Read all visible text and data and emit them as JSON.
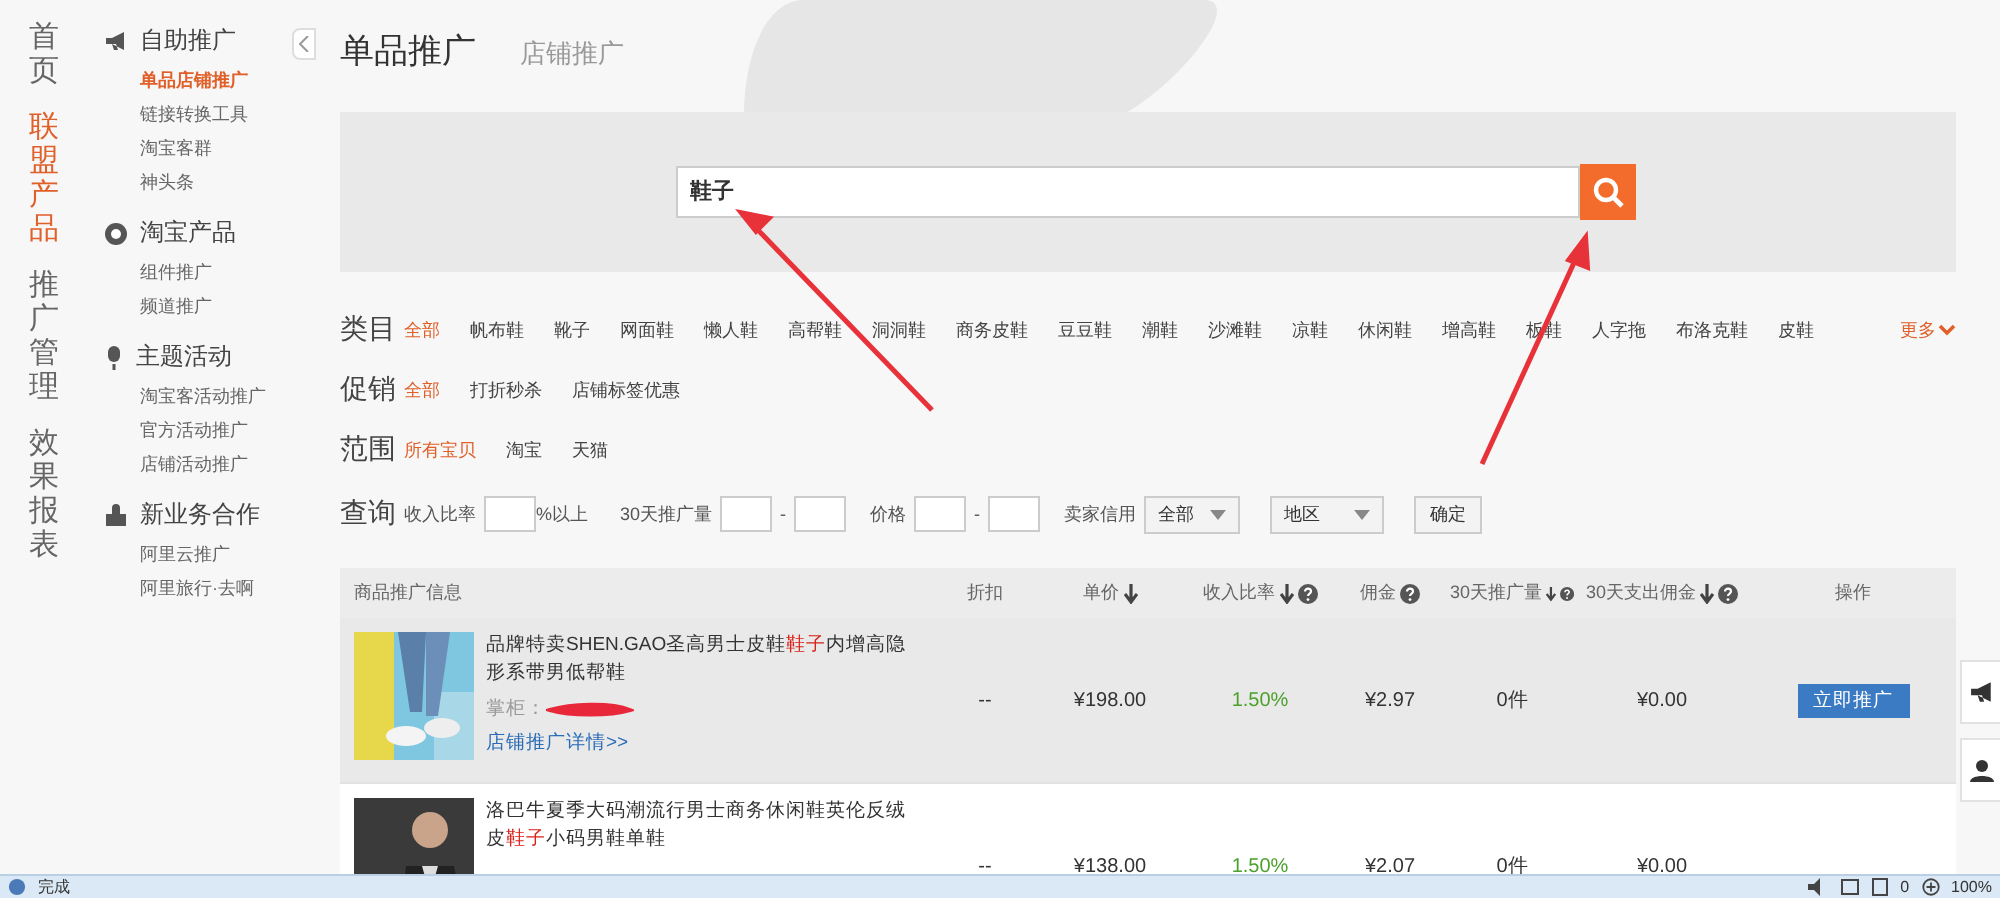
{
  "nav": [
    {
      "label": "首页",
      "selected": false
    },
    {
      "label": "联盟产品",
      "selected": true
    },
    {
      "label": "推广管理",
      "selected": false
    },
    {
      "label": "效果报表",
      "selected": false
    }
  ],
  "sidebar": {
    "groups": [
      {
        "title": "自助推广",
        "items": [
          {
            "label": "单品店铺推广",
            "selected": true
          },
          {
            "label": "链接转换工具",
            "selected": false
          },
          {
            "label": "淘宝客群",
            "selected": false
          },
          {
            "label": "神头条",
            "selected": false
          }
        ]
      },
      {
        "title": "淘宝产品",
        "items": [
          {
            "label": "组件推广",
            "selected": false
          },
          {
            "label": "频道推广",
            "selected": false
          }
        ]
      },
      {
        "title": "主题活动",
        "items": [
          {
            "label": "淘宝客活动推广",
            "selected": false
          },
          {
            "label": "官方活动推广",
            "selected": false
          },
          {
            "label": "店铺活动推广",
            "selected": false
          }
        ]
      },
      {
        "title": "新业务合作",
        "items": [
          {
            "label": "阿里云推广",
            "selected": false
          },
          {
            "label": "阿里旅行·去啊",
            "selected": false
          }
        ]
      }
    ]
  },
  "tabs": [
    {
      "label": "单品推广",
      "selected": true
    },
    {
      "label": "店铺推广",
      "selected": false
    }
  ],
  "search": {
    "value": "鞋子"
  },
  "filters": [
    {
      "label": "类目",
      "options": [
        {
          "label": "全部",
          "selected": true
        },
        {
          "label": "帆布鞋",
          "selected": false
        },
        {
          "label": "靴子",
          "selected": false
        },
        {
          "label": "网面鞋",
          "selected": false
        },
        {
          "label": "懒人鞋",
          "selected": false
        },
        {
          "label": "高帮鞋",
          "selected": false
        },
        {
          "label": "洞洞鞋",
          "selected": false
        },
        {
          "label": "商务皮鞋",
          "selected": false
        },
        {
          "label": "豆豆鞋",
          "selected": false
        },
        {
          "label": "潮鞋",
          "selected": false
        },
        {
          "label": "沙滩鞋",
          "selected": false
        },
        {
          "label": "凉鞋",
          "selected": false
        },
        {
          "label": "休闲鞋",
          "selected": false
        },
        {
          "label": "增高鞋",
          "selected": false
        },
        {
          "label": "板鞋",
          "selected": false
        },
        {
          "label": "人字拖",
          "selected": false
        },
        {
          "label": "布洛克鞋",
          "selected": false
        },
        {
          "label": "皮鞋",
          "selected": false
        }
      ],
      "more": "更多"
    },
    {
      "label": "促销",
      "options": [
        {
          "label": "全部",
          "selected": true
        },
        {
          "label": "打折秒杀",
          "selected": false
        },
        {
          "label": "店铺标签优惠",
          "selected": false
        }
      ]
    },
    {
      "label": "范围",
      "options": [
        {
          "label": "所有宝贝",
          "selected": true
        },
        {
          "label": "淘宝",
          "selected": false
        },
        {
          "label": "天猫",
          "selected": false
        }
      ]
    }
  ],
  "query": {
    "label": "查询",
    "ratio_label": "收入比率",
    "ratio_suffix": "%以上",
    "volume_label": "30天推广量",
    "dash_1": "-",
    "price_label": "价格",
    "dash_2": "-",
    "credit_label": "卖家信用",
    "credit_value": "全部",
    "region_value": "地区",
    "confirm": "确定"
  },
  "table": {
    "columns": [
      {
        "label": "商品推广信息",
        "sort": false,
        "help": false
      },
      {
        "label": "折扣",
        "sort": false,
        "help": false
      },
      {
        "label": "单价",
        "sort": true,
        "help": false
      },
      {
        "label": "收入比率",
        "sort": true,
        "help": true
      },
      {
        "label": "佣金",
        "sort": false,
        "help": true
      },
      {
        "label": "30天推广量",
        "sort": true,
        "help": true
      },
      {
        "label": "30天支出佣金",
        "sort": true,
        "help": true
      },
      {
        "label": "操作",
        "sort": false,
        "help": false
      }
    ],
    "rows": [
      {
        "title_before": "品牌特卖SHEN.GAO圣高男士皮鞋",
        "keyword": "鞋子",
        "title_after": "内增高隐形系带男低帮鞋",
        "seller": "掌柜：",
        "redacted": true,
        "link": "店铺推广详情>>",
        "discount": "--",
        "price": "¥198.00",
        "ratio": "1.50%",
        "commission": "¥2.97",
        "volume": "0件",
        "spend": "¥0.00",
        "action": "立即推广",
        "highlighted": true
      },
      {
        "title_before": "洛巴牛夏季大码潮流行男士商务休闲鞋英伦反绒皮",
        "keyword": "鞋子",
        "title_after": "小码男鞋单鞋",
        "discount": "--",
        "price": "¥138.00",
        "ratio": "1.50%",
        "commission": "¥2.07",
        "volume": "0件",
        "spend": "¥0.00",
        "highlighted": false
      }
    ]
  },
  "status_bar": {
    "text": "完成",
    "count": "0",
    "zoom": "100%"
  }
}
